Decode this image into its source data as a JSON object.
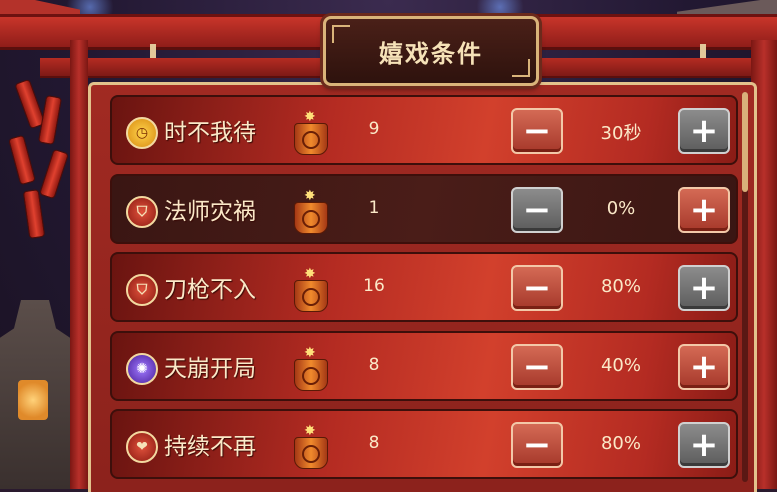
{
  "title": "嬉戏条件",
  "rows": [
    {
      "name": "时不我待",
      "icon": "clock-icon",
      "icon_glyph": "◷",
      "count": "9",
      "value": "30秒",
      "style": "red",
      "minus_style": "red",
      "plus_style": "grey"
    },
    {
      "name": "法师灾祸",
      "icon": "shield-icon",
      "icon_glyph": "⛉",
      "count": "1",
      "value": "0%",
      "style": "dark",
      "minus_style": "grey",
      "plus_style": "red"
    },
    {
      "name": "刀枪不入",
      "icon": "shield-icon",
      "icon_glyph": "⛉",
      "count": "16",
      "value": "80%",
      "style": "red",
      "minus_style": "red",
      "plus_style": "grey"
    },
    {
      "name": "天崩开局",
      "icon": "starburst-icon",
      "icon_glyph": "✺",
      "count": "8",
      "value": "40%",
      "style": "red",
      "minus_style": "red",
      "plus_style": "red"
    },
    {
      "name": "持续不再",
      "icon": "heart-shield-icon",
      "icon_glyph": "❤",
      "count": "8",
      "value": "80%",
      "style": "red",
      "minus_style": "red",
      "plus_style": "grey"
    }
  ],
  "buttons": {
    "minus_glyph": "−",
    "plus_glyph": "+"
  },
  "colors": {
    "panel": "#a12a22",
    "gold_trim": "#e3c28c",
    "text": "#fbe9c8"
  }
}
